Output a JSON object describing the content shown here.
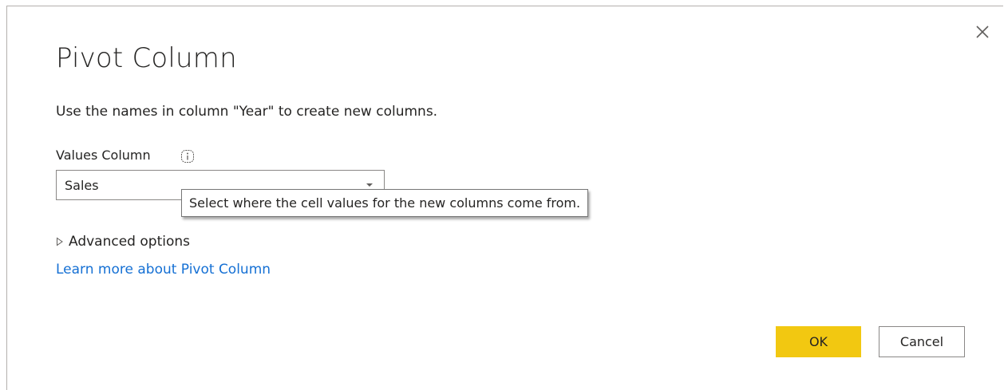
{
  "dialog": {
    "title": "Pivot Column",
    "description": "Use the names in column \"Year\" to create new columns.",
    "values_column_label": "Values Column",
    "values_column_selected": "Sales",
    "tooltip": "Select where the cell values for the new columns come from.",
    "advanced_options_label": "Advanced options",
    "learn_more_link": "Learn more about Pivot Column",
    "ok_label": "OK",
    "cancel_label": "Cancel"
  },
  "icons": {
    "close": "close-icon",
    "info": "info-icon",
    "expand": "triangle-right-icon",
    "dropdown": "chevron-down-icon"
  },
  "colors": {
    "primary_button": "#f2c811",
    "link": "#1570d4",
    "text": "#252423",
    "border": "#8a8886"
  }
}
